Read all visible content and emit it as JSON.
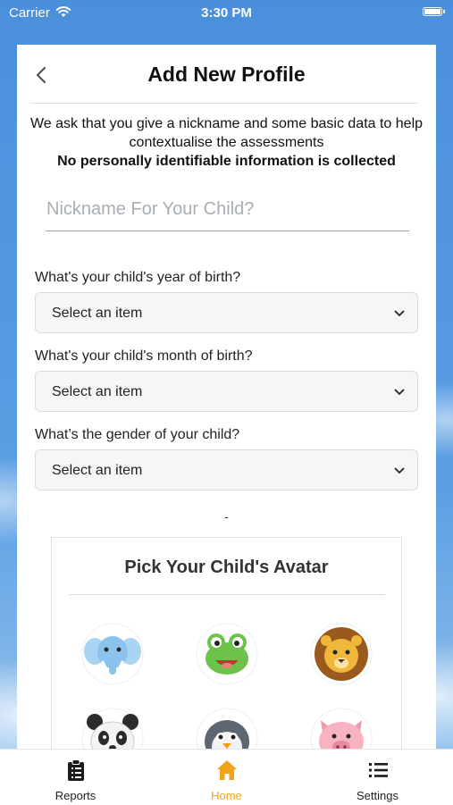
{
  "status_bar": {
    "carrier": "Carrier",
    "time": "3:30 PM"
  },
  "header": {
    "title": "Add New Profile",
    "back_icon": "chevron-left-icon"
  },
  "intro": {
    "line": "We ask that you give a nickname and some basic data to help contextualise the assessments",
    "bold": "No personally identifiable information is collected"
  },
  "nickname": {
    "placeholder": "Nickname For Your Child?",
    "value": ""
  },
  "fields": [
    {
      "label": "What's your child's year of birth?",
      "value": "Select an item"
    },
    {
      "label": "What's your child's month of birth?",
      "value": "Select an item"
    },
    {
      "label": "What’s the gender of your child?",
      "value": "Select an item"
    }
  ],
  "separator": "-",
  "avatar_picker": {
    "title": "Pick Your Child's Avatar",
    "avatars": [
      "elephant",
      "frog",
      "lion",
      "panda",
      "penguin",
      "pig"
    ]
  },
  "tabs": [
    {
      "label": "Reports",
      "icon": "clipboard-icon",
      "active": false
    },
    {
      "label": "Home",
      "icon": "home-icon",
      "active": true
    },
    {
      "label": "Settings",
      "icon": "list-icon",
      "active": false
    }
  ],
  "colors": {
    "accent": "#f2a21b",
    "background": "#4a90d9"
  }
}
